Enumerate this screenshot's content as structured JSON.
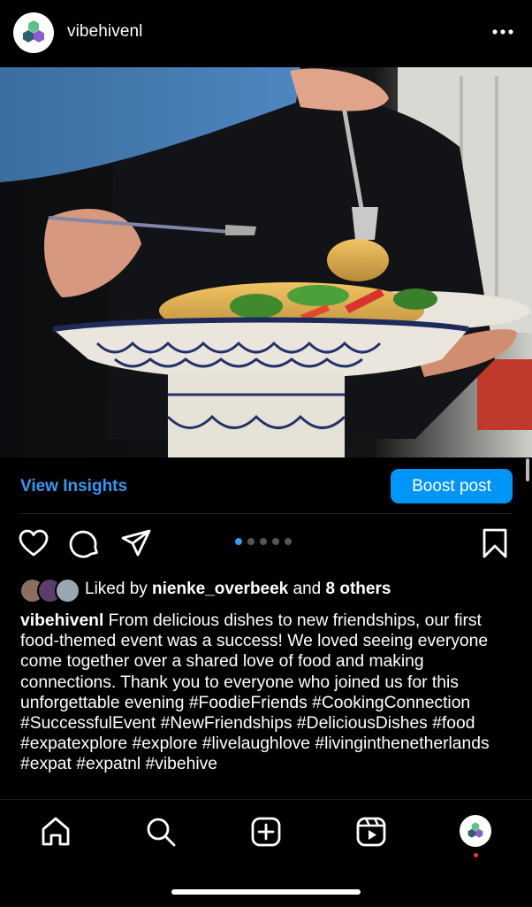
{
  "post": {
    "username": "vibehivenl",
    "image_alt": "Person eating noodles from a decorated blue-and-white pedestal bowl"
  },
  "insights": {
    "view_label": "View Insights",
    "boost_label": "Boost post"
  },
  "carousel": {
    "count": 5,
    "active_index": 0
  },
  "likes": {
    "prefix": "Liked by ",
    "user": "nienke_overbeek",
    "middle": " and ",
    "others": "8 others"
  },
  "caption": {
    "username": "vibehivenl",
    "text": "From delicious dishes to new friendships, our first food-themed event was a success! We loved seeing everyone come together over a shared love of food and making connections. Thank you to everyone who joined us for this unforgettable evening #FoodieFriends #CookingConnection #SuccessfulEvent #NewFriendships #DeliciousDishes #food #expatexplore #explore #livelaughlove #livinginthenetherlands #expat #expatnl #vibehive"
  },
  "colors": {
    "accent_blue": "#3897f0",
    "boost_blue": "#0095f6",
    "logo_green": "#5cc28a",
    "logo_purple": "#8b5fc7",
    "logo_teal": "#2f5f6a",
    "notification_red": "#ff3040"
  },
  "icons": {
    "more": "more-horizontal-icon",
    "like": "heart-icon",
    "comment": "comment-icon",
    "share": "paper-plane-icon",
    "save": "bookmark-icon",
    "home": "home-icon",
    "search": "search-icon",
    "create": "plus-square-icon",
    "reels": "reels-icon"
  }
}
